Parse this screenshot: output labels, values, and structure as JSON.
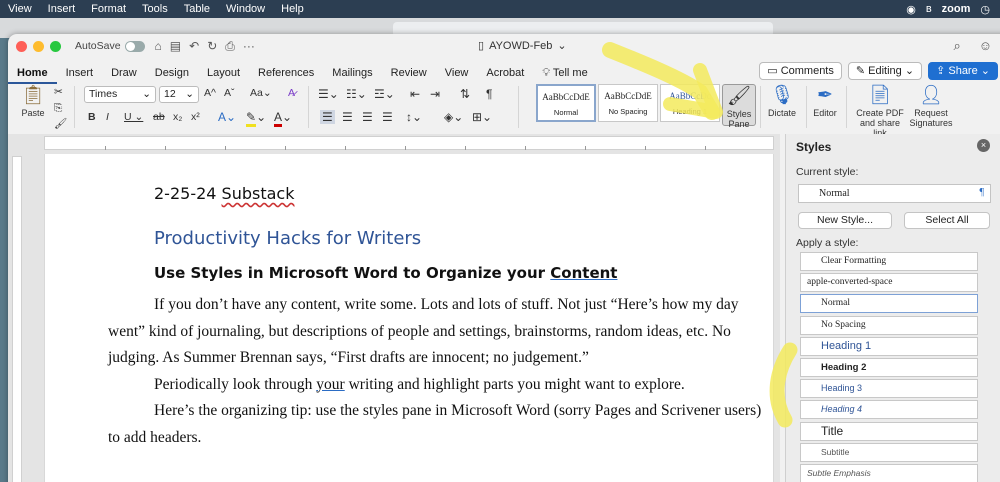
{
  "menubar": {
    "items": [
      "View",
      "Insert",
      "Format",
      "Tools",
      "Table",
      "Window",
      "Help"
    ],
    "zoom_label": "zoom"
  },
  "window": {
    "autosave_label": "AutoSave",
    "doc_title": "AYOWD-Feb"
  },
  "tabs": [
    "Home",
    "Insert",
    "Draw",
    "Design",
    "Layout",
    "References",
    "Mailings",
    "Review",
    "View",
    "Acrobat"
  ],
  "tell_me": "Tell me",
  "header_buttons": {
    "comments": "Comments",
    "editing": "Editing",
    "share": "Share"
  },
  "ribbon": {
    "paste_label": "Paste",
    "font_name": "Times",
    "font_size": "12",
    "style_gallery": [
      {
        "preview": "AaBbCcDdE",
        "name": "Normal"
      },
      {
        "preview": "AaBbCcDdE",
        "name": "No Spacing"
      },
      {
        "preview": "AaBbCcDc",
        "name": "Heading 1"
      }
    ],
    "styles_pane_label": "Styles Pane",
    "dictate_label": "Dictate",
    "editor_label": "Editor",
    "create_pdf_label": "Create PDF and share link",
    "request_sig_label": "Request Signatures"
  },
  "document": {
    "date_line": {
      "prefix": "2-25-24 ",
      "underlined": "Substack"
    },
    "heading1": "Productivity Hacks for Writers",
    "heading2": {
      "prefix": "Use Styles in Microsoft Word to Organize your ",
      "underlined": "Content"
    },
    "paragraph1": "If you don’t have any content, write some. Lots and lots of stuff. Not just “Here’s how my day went” kind of journaling, but descriptions of people and settings, brainstorms, random ideas, etc. No judging. As Summer Brennan says, “First drafts are innocent; no judgement.”",
    "paragraph2": {
      "prefix": "Periodically look through ",
      "underlined": "your",
      "suffix": " writing and highlight parts you might want to explore."
    },
    "paragraph3": "Here’s the organizing tip: use the styles pane in Microsoft Word (sorry Pages and Scrivener users) to add headers."
  },
  "styles_pane": {
    "title": "Styles",
    "current_style_label": "Current style:",
    "current_style_value": "Normal",
    "new_style_button": "New Style...",
    "select_all_button": "Select All",
    "apply_label": "Apply a style:",
    "styles": [
      "Clear Formatting",
      "apple-converted-space",
      "Normal",
      "No Spacing",
      "Heading 1",
      "Heading 2",
      "Heading 3",
      "Heading 4",
      "Title",
      "Subtitle",
      "Subtle Emphasis"
    ]
  },
  "colors": {
    "accent": "#2b579a",
    "share": "#1f6fd1",
    "heading": "#2f5496",
    "highlighter": "#f3ea5d"
  }
}
